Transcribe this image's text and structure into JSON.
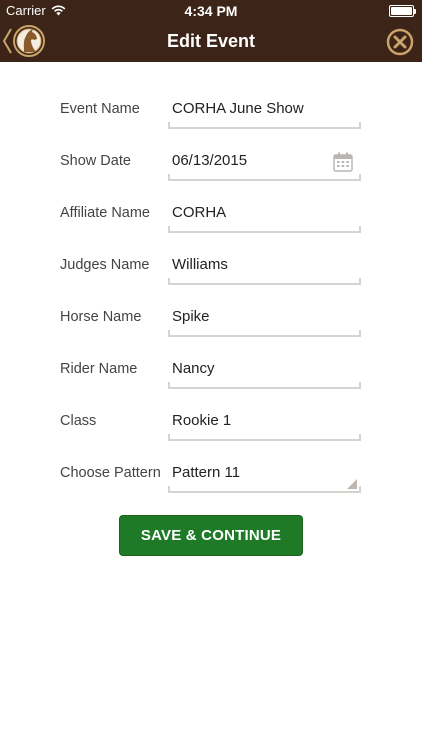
{
  "status": {
    "carrier": "Carrier",
    "time": "4:34 PM"
  },
  "nav": {
    "title": "Edit Event",
    "back_icon": "horse-logo-back-icon",
    "close_icon": "close-circle-icon"
  },
  "colors": {
    "header": "#3d2418",
    "accent_gold": "#c9a46a",
    "button": "#1f7a28"
  },
  "form": {
    "fields": [
      {
        "label": "Event Name",
        "value": "CORHA June Show"
      },
      {
        "label": "Show Date",
        "value": "06/13/2015"
      },
      {
        "label": "Affiliate Name",
        "value": "CORHA"
      },
      {
        "label": "Judges Name",
        "value": "Williams"
      },
      {
        "label": "Horse Name",
        "value": "Spike"
      },
      {
        "label": "Rider Name",
        "value": "Nancy"
      },
      {
        "label": "Class",
        "value": "Rookie 1"
      },
      {
        "label": "Choose Pattern",
        "value": "Pattern 11"
      }
    ]
  },
  "actions": {
    "save_label": "SAVE & CONTINUE"
  }
}
